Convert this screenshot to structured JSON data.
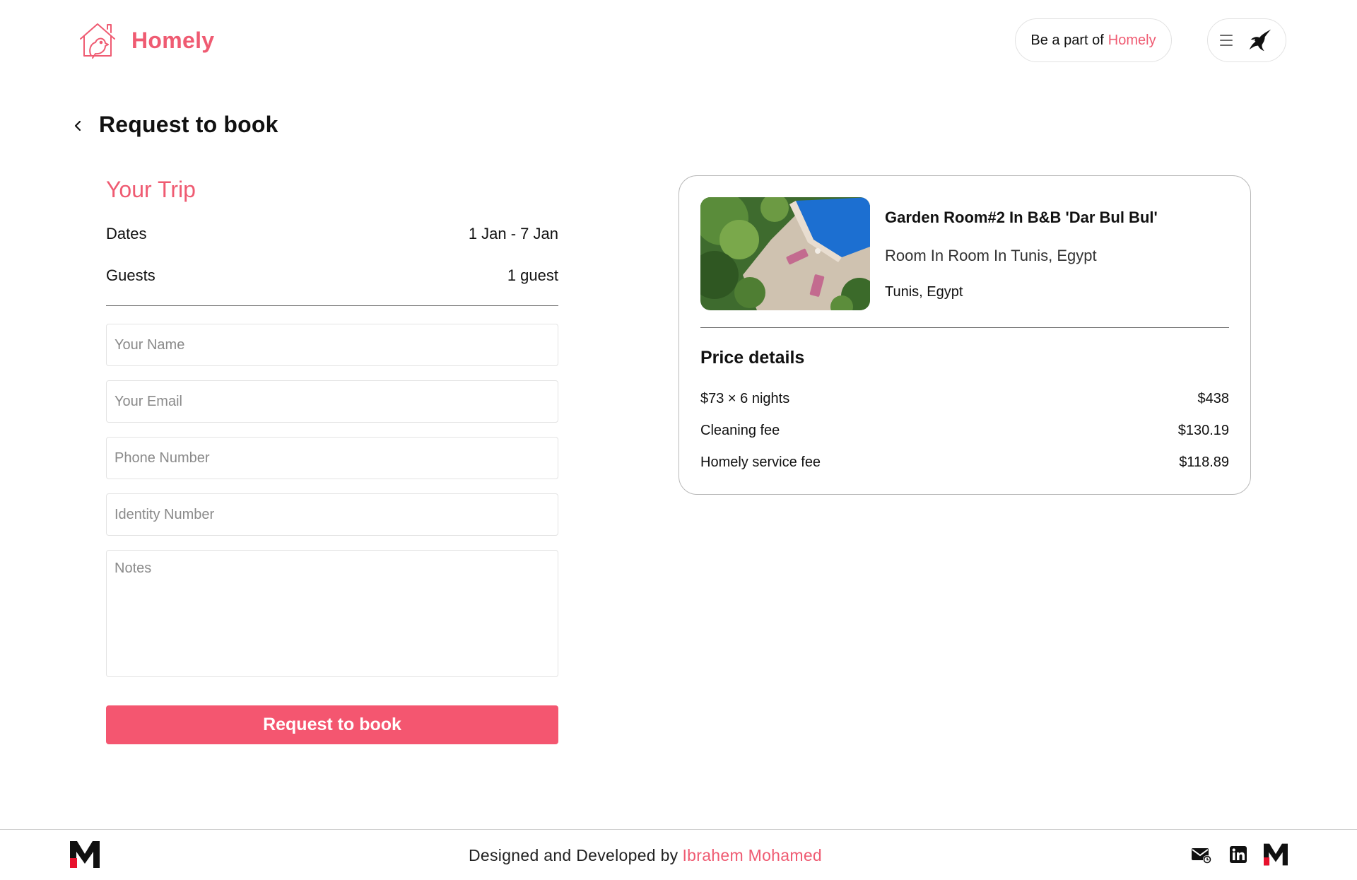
{
  "header": {
    "brand": "Homely",
    "host_prefix": "Be a part of",
    "host_brand": "Homely"
  },
  "page": {
    "title": "Request to book"
  },
  "trip": {
    "heading": "Your Trip",
    "dates_label": "Dates",
    "dates_value": "1 Jan - 7 Jan",
    "guests_label": "Guests",
    "guests_value": "1 guest"
  },
  "form": {
    "name_placeholder": "Your Name",
    "email_placeholder": "Your Email",
    "phone_placeholder": "Phone Number",
    "identity_placeholder": "Identity Number",
    "notes_placeholder": "Notes",
    "submit_label": "Request to book"
  },
  "listing": {
    "name": "Garden Room#2 In B&B 'Dar Bul Bul'",
    "type": "Room In Room In Tunis, Egypt",
    "location": "Tunis, Egypt"
  },
  "price": {
    "heading": "Price details",
    "rows": [
      {
        "label": "$73 × 6 nights",
        "value": "$438"
      },
      {
        "label": "Cleaning fee",
        "value": "$130.19"
      },
      {
        "label": "Homely service fee",
        "value": "$118.89"
      }
    ]
  },
  "footer": {
    "credit_prefix": "Designed and Developed by",
    "author": "Ibrahem Mohamed"
  },
  "icons": {
    "logo": "house-bird-icon",
    "menu": "hamburger-icon",
    "avatar": "swallow-bird-icon",
    "back": "chevron-left-icon",
    "footer_logo": "m-logo-icon",
    "mail": "mail-icon",
    "linkedin": "linkedin-icon"
  },
  "colors": {
    "brand": "#ef5b72",
    "button": "#f45670",
    "text": "#111111",
    "border": "#e3e3e3"
  }
}
